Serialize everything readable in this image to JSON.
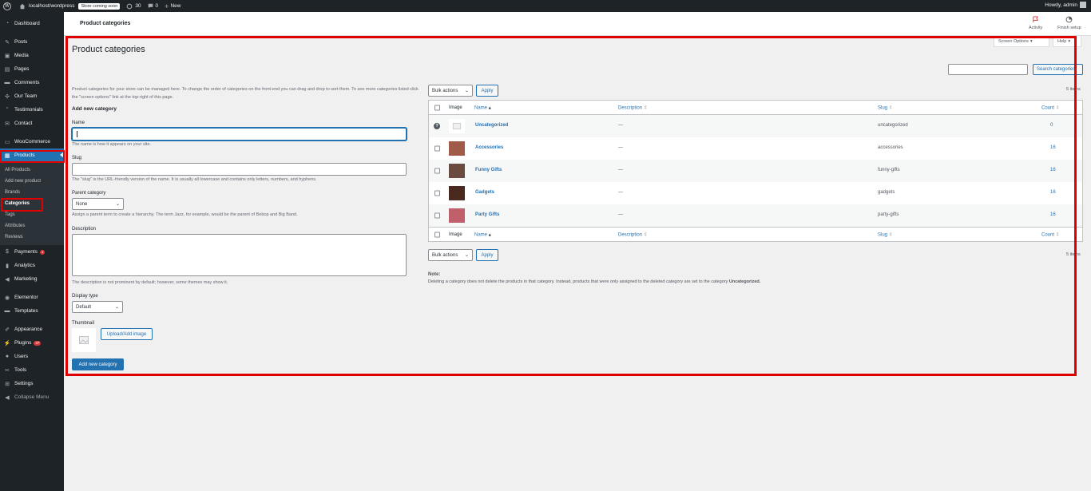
{
  "adminbar": {
    "site": "localhost/wordpress",
    "store_badge": "Store coming soon",
    "comments_count": "30",
    "updates_count": "0",
    "new_label": "New",
    "howdy": "Howdy, admin"
  },
  "sidebar": {
    "items": [
      {
        "label": "Dashboard",
        "icon": "dashboard-icon"
      },
      {
        "label": "Posts",
        "icon": "pin-icon"
      },
      {
        "label": "Media",
        "icon": "media-icon"
      },
      {
        "label": "Pages",
        "icon": "page-icon"
      },
      {
        "label": "Comments",
        "icon": "comment-icon"
      },
      {
        "label": "Our Team",
        "icon": "team-icon"
      },
      {
        "label": "Testimonials",
        "icon": "quote-icon"
      },
      {
        "label": "Contact",
        "icon": "mail-icon"
      },
      {
        "label": "WooCommerce",
        "icon": "woo-icon"
      },
      {
        "label": "Products",
        "icon": "archive-icon"
      }
    ],
    "submenu": [
      "All Products",
      "Add new product",
      "Brands",
      "Categories",
      "Tags",
      "Attributes",
      "Reviews"
    ],
    "items2": [
      {
        "label": "Payments",
        "icon": "payments-icon",
        "badge": "1"
      },
      {
        "label": "Analytics",
        "icon": "chart-icon"
      },
      {
        "label": "Marketing",
        "icon": "megaphone-icon"
      },
      {
        "label": "Elementor",
        "icon": "elementor-icon"
      },
      {
        "label": "Templates",
        "icon": "folder-icon"
      },
      {
        "label": "Appearance",
        "icon": "brush-icon"
      },
      {
        "label": "Plugins",
        "icon": "plugin-icon",
        "badge": "37"
      },
      {
        "label": "Users",
        "icon": "users-icon"
      },
      {
        "label": "Tools",
        "icon": "wrench-icon"
      },
      {
        "label": "Settings",
        "icon": "settings-icon"
      },
      {
        "label": "Collapse Menu",
        "icon": "collapse-icon"
      }
    ]
  },
  "topbar": {
    "breadcrumb": "Product categories",
    "activity": "Activity",
    "finish_setup": "Finish setup"
  },
  "main": {
    "title": "Product categories",
    "screen_options": "Screen Options",
    "help": "Help",
    "search_button": "Search categories",
    "intro": "Product categories for your store can be managed here. To change the order of categories on the front-end you can drag and drop to sort them. To see more categories listed click the \"screen options\" link at the top-right of this page.",
    "form": {
      "heading": "Add new category",
      "name_label": "Name",
      "name_help": "The name is how it appears on your site.",
      "slug_label": "Slug",
      "slug_help": "The \"slug\" is the URL-friendly version of the name. It is usually all lowercase and contains only letters, numbers, and hyphens.",
      "parent_label": "Parent category",
      "parent_value": "None",
      "parent_help": "Assign a parent term to create a hierarchy. The term Jazz, for example, would be the parent of Bebop and Big Band.",
      "description_label": "Description",
      "description_help": "The description is not prominent by default; however, some themes may show it.",
      "display_label": "Display type",
      "display_value": "Default",
      "thumbnail_label": "Thumbnail",
      "upload_button": "Upload/Add image",
      "submit": "Add new category"
    },
    "bulk_actions": "Bulk actions",
    "apply": "Apply",
    "items_count": "5 items",
    "columns": {
      "image": "Image",
      "name": "Name",
      "description": "Description",
      "slug": "Slug",
      "count": "Count"
    },
    "rows": [
      {
        "name": "Uncategorized",
        "description": "—",
        "slug": "uncategorized",
        "count": "0",
        "help": true,
        "thumb_color": "#eeeeee"
      },
      {
        "name": "Accessories",
        "description": "—",
        "slug": "accessories",
        "count": "16",
        "help": false,
        "thumb_color": "#a05a4a"
      },
      {
        "name": "Funny Gifts",
        "description": "—",
        "slug": "funny-gifts",
        "count": "16",
        "help": false,
        "thumb_color": "#6b4a3f"
      },
      {
        "name": "Gadgets",
        "description": "—",
        "slug": "gadgets",
        "count": "16",
        "help": false,
        "thumb_color": "#4a2a1e"
      },
      {
        "name": "Party Gifts",
        "description": "—",
        "slug": "party-gifts",
        "count": "16",
        "help": false,
        "thumb_color": "#c0606a"
      }
    ],
    "note_title": "Note:",
    "note_text": "Deleting a category does not delete the products in that category. Instead, products that were only assigned to the deleted category are set to the category",
    "note_strong": "Uncategorized."
  }
}
